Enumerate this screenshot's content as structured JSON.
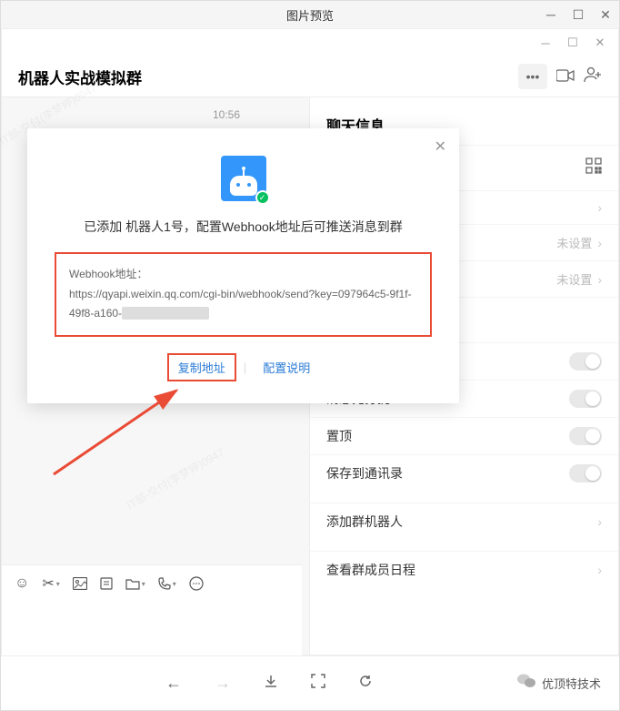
{
  "preview": {
    "title": "图片预览"
  },
  "chat": {
    "title": "机器人实战模拟群",
    "timestamp": "10:56",
    "watermark": "IT部-交付(李梦婷)0947"
  },
  "side": {
    "title": "聊天信息",
    "unset": "未设置",
    "rows": {
      "dnd": "消息免打扰",
      "top": "置顶",
      "save": "保存到通讯录",
      "addBot": "添加群机器人",
      "schedule": "查看群成员日程"
    }
  },
  "modal": {
    "message": "已添加 机器人1号，配置Webhook地址后可推送消息到群",
    "webhook_label": "Webhook地址：",
    "webhook_url": "https://qyapi.weixin.qq.com/cgi-bin/webhook/send?key=097964c5-9f1f-49f8-a160-",
    "copy": "复制地址",
    "config": "配置说明"
  },
  "brand": "优顶特技术"
}
